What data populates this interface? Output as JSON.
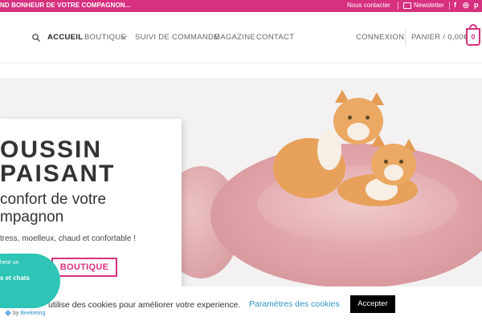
{
  "topbar": {
    "promo": "ND BONHEUR DE VOTRE COMPAGNON...",
    "contact": "Nous contacter",
    "newsletter": "Newsletter",
    "social": [
      "f",
      "◎",
      "p"
    ]
  },
  "header": {
    "nav": [
      "ACCUEIL",
      "BOUTIQUE",
      "SUIVI DE COMMANDE",
      "MAGAZINE",
      "CONTACT"
    ],
    "login": "CONNEXION",
    "cart": "PANIER / 0,00€",
    "cart_count": "0"
  },
  "hero": {
    "title_line1": "OUSSIN",
    "title_line2": "PAISANT",
    "subtitle_line1": "confort de votre",
    "subtitle_line2": "mpagnon",
    "description": "tress, moelleux, chaud et confortable !",
    "cta": "BOUTIQUE"
  },
  "popup": {
    "line1": "heté un",
    "line2": "s et chats"
  },
  "cookie": {
    "text": "utilise des cookies pour améliorer votre experience.",
    "settings": "Paramètres des cookies",
    "accept": "Accepter"
  },
  "beeketing": {
    "prefix": "by",
    "brand": "Beeketing"
  },
  "colors": {
    "accent": "#d6307e",
    "popup": "#2ec4b6",
    "link": "#2e93c6"
  }
}
